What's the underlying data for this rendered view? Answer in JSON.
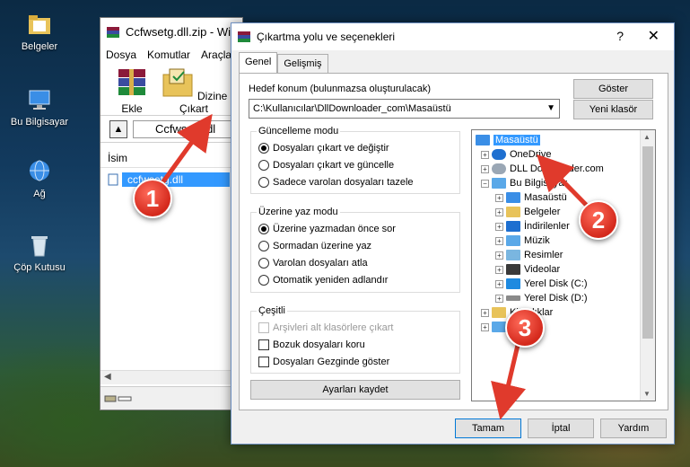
{
  "desktop": {
    "icons": [
      {
        "label": "Belgeler"
      },
      {
        "label": "Bu Bilgisayar"
      },
      {
        "label": "Ağ"
      },
      {
        "label": "Çöp Kutusu"
      }
    ]
  },
  "winrar": {
    "title": "Ccfwsetg.dll.zip - Wi",
    "menu": [
      "Dosya",
      "Komutlar",
      "Araçla"
    ],
    "tools": {
      "add": "Ekle",
      "extract": "Dizine Çıkart"
    },
    "path": "Ccfwsetg.dl",
    "column_name": "İsim",
    "file": "ccfwsetg.dll"
  },
  "dialog": {
    "title": "Çıkartma yolu ve seçenekleri",
    "help_glyph": "?",
    "close_glyph": "✕",
    "tabs": [
      "Genel",
      "Gelişmiş"
    ],
    "target_label": "Hedef konum (bulunmazsa oluşturulacak)",
    "target_value": "C:\\Kullanıcılar\\DllDownloader_com\\Masaüstü",
    "show_button": "Göster",
    "new_folder_button": "Yeni klasör",
    "update_mode": {
      "title": "Güncelleme modu",
      "options": [
        "Dosyaları çıkart ve değiştir",
        "Dosyaları çıkart ve güncelle",
        "Sadece varolan dosyaları tazele"
      ],
      "selected": 0
    },
    "overwrite_mode": {
      "title": "Üzerine yaz modu",
      "options": [
        "Üzerine yazmadan önce sor",
        "Sormadan üzerine yaz",
        "Varolan dosyaları atla",
        "Otomatik yeniden adlandır"
      ],
      "selected": 0
    },
    "misc": {
      "title": "Çeşitli",
      "options": [
        "Arşivleri alt klasörlere çıkart",
        "Bozuk dosyaları koru",
        "Dosyaları Gezginde göster"
      ]
    },
    "save_settings": "Ayarları kaydet",
    "tree": [
      {
        "label": "Masaüstü",
        "selected": true
      },
      {
        "label": "OneDrive"
      },
      {
        "label": "DLL Downloader.com"
      },
      {
        "label": "Bu Bilgisayar"
      },
      {
        "label": "Masaüstü"
      },
      {
        "label": "Belgeler"
      },
      {
        "label": "İndirilenler"
      },
      {
        "label": "Müzik"
      },
      {
        "label": "Resimler"
      },
      {
        "label": "Videolar"
      },
      {
        "label": "Yerel Disk (C:)"
      },
      {
        "label": "Yerel Disk (D:)"
      },
      {
        "label": "Kitaplıklar"
      },
      {
        "label": "Ağ"
      }
    ],
    "buttons": {
      "ok": "Tamam",
      "cancel": "İptal",
      "help": "Yardım"
    }
  },
  "callouts": [
    "1",
    "2",
    "3"
  ],
  "colors": {
    "accent": "#3399ff",
    "callout": "#d4291c"
  }
}
